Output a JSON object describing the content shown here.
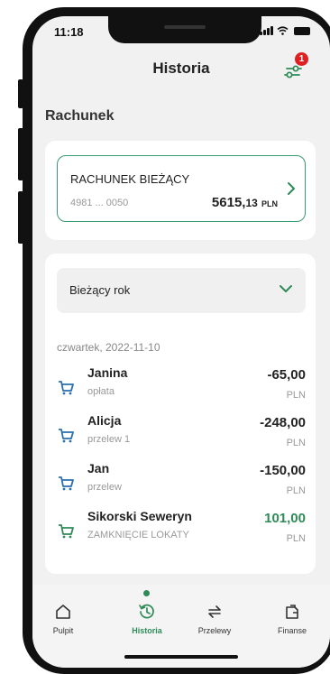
{
  "status": {
    "time": "11:18"
  },
  "header": {
    "title": "Historia",
    "filter_badge": "1"
  },
  "section": {
    "title": "Rachunek"
  },
  "account": {
    "name": "RACHUNEK BIEŻĄCY",
    "number": "4981 ... 0050",
    "balance_main": "5615,",
    "balance_cents": "13",
    "balance_currency": "PLN"
  },
  "history": {
    "period": "Bieżący rok",
    "date": "czwartek, 2022-11-10",
    "transactions": [
      {
        "name": "Janina",
        "desc": "opłata",
        "amount": "-65,00",
        "currency": "PLN",
        "positive": false
      },
      {
        "name": "Alicja",
        "desc": "przelew 1",
        "amount": "-248,00",
        "currency": "PLN",
        "positive": false
      },
      {
        "name": "Jan",
        "desc": "przelew",
        "amount": "-150,00",
        "currency": "PLN",
        "positive": false
      },
      {
        "name": "Sikorski Seweryn",
        "desc": "ZAMKNIĘCIE LOKATY",
        "amount": "101,00",
        "currency": "PLN",
        "positive": true
      }
    ]
  },
  "nav": {
    "items": [
      {
        "label": "Pulpit",
        "icon": "home-icon"
      },
      {
        "label": "Historia",
        "icon": "history-icon",
        "active": true
      },
      {
        "label": "Przelewy",
        "icon": "transfer-icon"
      },
      {
        "label": "Finanse",
        "icon": "finance-icon"
      }
    ]
  },
  "colors": {
    "accent": "#2e8b57",
    "badge": "#e02020",
    "card_border": "#3a9a70"
  }
}
